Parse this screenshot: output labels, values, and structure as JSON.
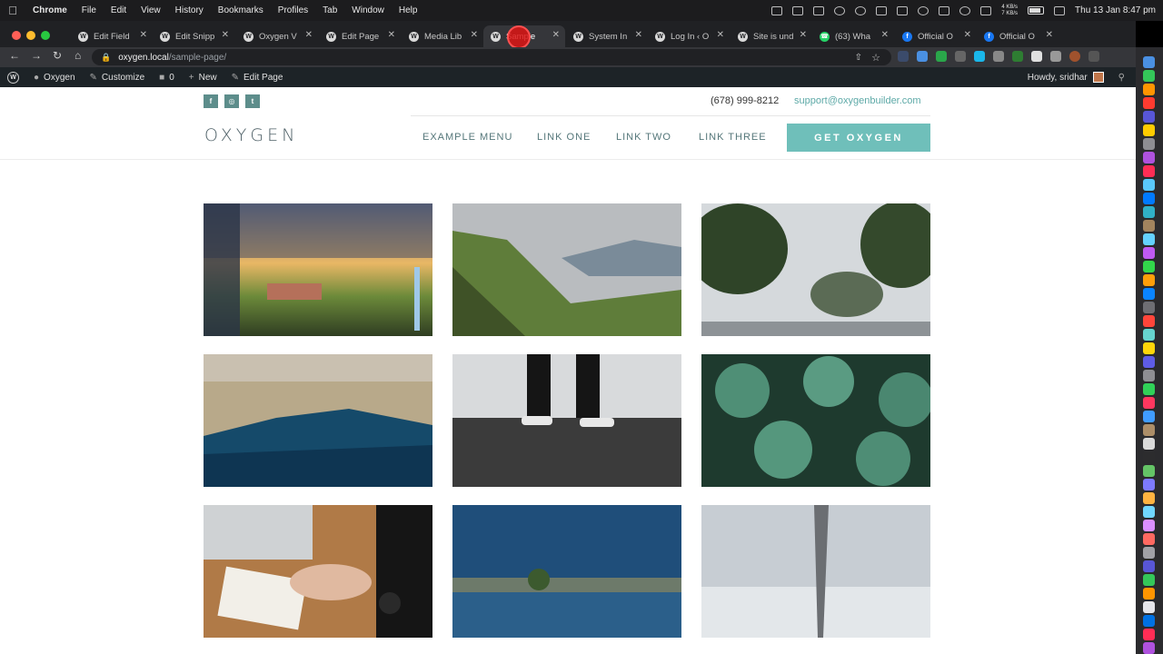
{
  "menubar": {
    "app": "Chrome",
    "items": [
      "File",
      "Edit",
      "View",
      "History",
      "Bookmarks",
      "Profiles",
      "Tab",
      "Window",
      "Help"
    ],
    "net_up": "4 KB/s",
    "net_down": "7 KB/s",
    "clock": "Thu 13 Jan  8:47 pm"
  },
  "browser": {
    "tabs": [
      {
        "title": "Edit Field",
        "icon": "wordpress-icon"
      },
      {
        "title": "Edit Snipp",
        "icon": "wordpress-icon"
      },
      {
        "title": "Oxygen V",
        "icon": "wordpress-icon"
      },
      {
        "title": "Edit Page",
        "icon": "wordpress-icon"
      },
      {
        "title": "Media Lib",
        "icon": "wordpress-icon"
      },
      {
        "title": "Sample",
        "icon": "wordpress-icon"
      },
      {
        "title": "System In",
        "icon": "wordpress-icon"
      },
      {
        "title": "Log In ‹ O",
        "icon": "wordpress-icon"
      },
      {
        "title": "Site is und",
        "icon": "wordpress-icon"
      },
      {
        "title": "(63) Wha",
        "icon": "whatsapp-icon"
      },
      {
        "title": "Official O",
        "icon": "facebook-icon"
      },
      {
        "title": "Official O",
        "icon": "facebook-icon"
      }
    ],
    "active_tab": 5,
    "url_host": "oxygen.local",
    "url_path": "/sample-page/"
  },
  "wp_admin_bar": {
    "site_name": "Oxygen",
    "customize": "Customize",
    "comments": "0",
    "new": "New",
    "edit_page": "Edit Page",
    "howdy": "Howdy, sridhar"
  },
  "site": {
    "phone": "(678) 999-8212",
    "email": "support@oxygenbuilder.com",
    "logo": "OXYGEN",
    "menu": [
      "EXAMPLE MENU",
      "LINK ONE",
      "LINK TWO",
      "LINK THREE"
    ],
    "cta": "GET OXYGEN",
    "social": [
      "f",
      "◎",
      "t"
    ],
    "accent_color": "#6fbfba"
  }
}
